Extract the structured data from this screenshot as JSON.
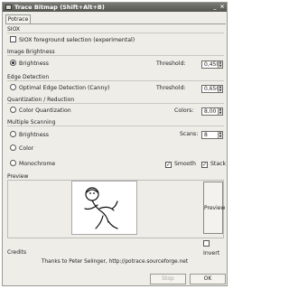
{
  "window": {
    "title": "Trace Bitmap (Shift+Alt+B)",
    "tab": "Potrace"
  },
  "siox": {
    "label": "SIOX",
    "checkbox": "SIOX foreground selection (experimental)",
    "checked": false
  },
  "image_brightness": {
    "label": "Image Brightness",
    "option": "Brightness",
    "selected": true,
    "threshold_label": "Threshold:",
    "threshold_value": "0,450"
  },
  "edge_detection": {
    "label": "Edge Detection",
    "option": "Optimal Edge Detection (Canny)",
    "selected": false,
    "threshold_label": "Threshold:",
    "threshold_value": "0,650"
  },
  "quantization": {
    "label": "Quantization / Reduction",
    "option": "Color Quantization",
    "selected": false,
    "colors_label": "Colors:",
    "colors_value": "8,00"
  },
  "multiple_scanning": {
    "label": "Multiple Scanning",
    "options": [
      "Brightness",
      "Color",
      "Monochrome"
    ],
    "scans_label": "Scans:",
    "scans_value": "8",
    "smooth_label": "Smooth",
    "smooth_checked": true,
    "stack_label": "Stack",
    "stack_checked": true
  },
  "preview": {
    "label": "Preview",
    "button": "Preview",
    "invert_label": "Invert",
    "invert_checked": false
  },
  "credits": {
    "label": "Credits",
    "text": "Thanks to Peter Selinger, http://potrace.sourceforge.net"
  },
  "buttons": {
    "stop": "Stop",
    "ok": "OK"
  }
}
